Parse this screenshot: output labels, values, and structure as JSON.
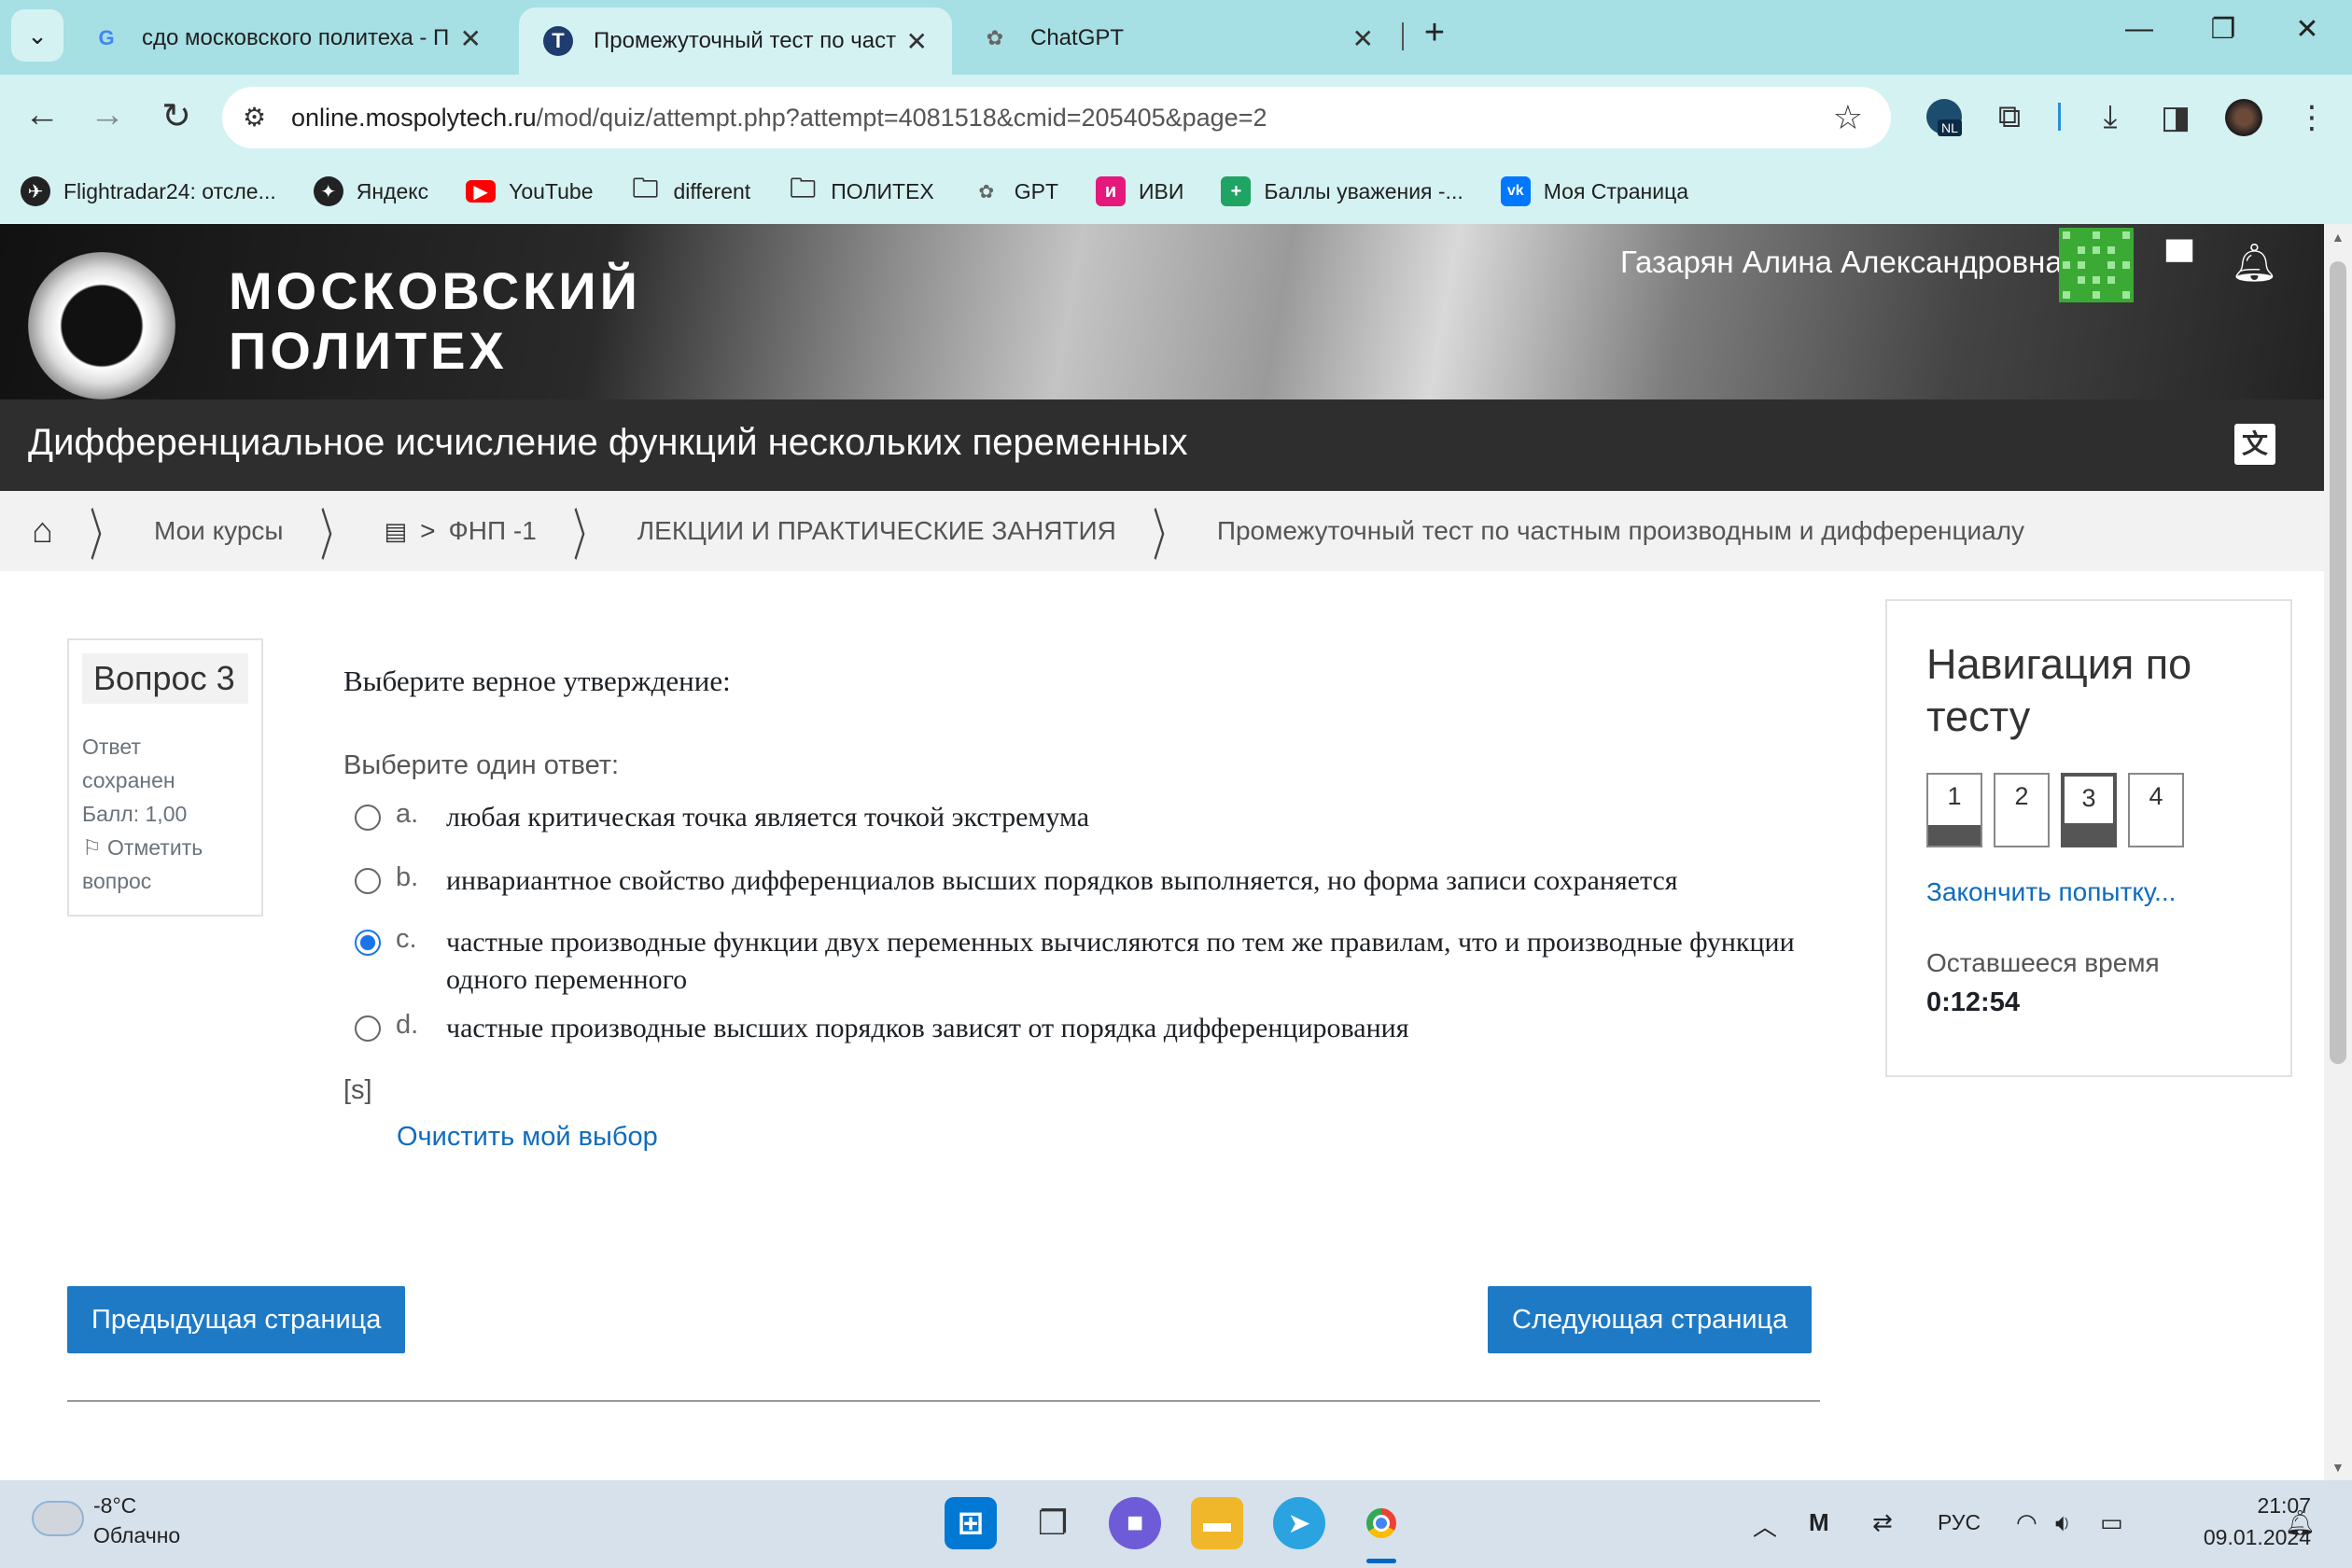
{
  "browser": {
    "tabs": [
      {
        "label": "сдо московского политеха - П",
        "icon": "google-icon"
      },
      {
        "label": "Промежуточный тест по частн",
        "icon": "moodle-icon",
        "active": true
      },
      {
        "label": "ChatGPT",
        "icon": "chatgpt-icon"
      }
    ],
    "new_tab": "+",
    "url_domain": "online.mospolytech.ru",
    "url_path": "/mod/quiz/attempt.php?attempt=4081518&cmid=205405&page=2",
    "bookmarks": [
      {
        "label": "Flightradar24: отсле...",
        "icon": "flightradar-icon",
        "color": "#222222"
      },
      {
        "label": "Яндекс",
        "icon": "yandex-icon",
        "color": "#222222"
      },
      {
        "label": "YouTube",
        "icon": "youtube-icon",
        "color": "#ff0000"
      },
      {
        "label": "different",
        "icon": "folder-icon",
        "color": ""
      },
      {
        "label": "ПОЛИТЕХ",
        "icon": "folder-icon",
        "color": ""
      },
      {
        "label": "GPT",
        "icon": "chatgpt-icon",
        "color": "#888888"
      },
      {
        "label": "ИВИ",
        "icon": "ivi-icon",
        "color": "#e5197c"
      },
      {
        "label": "Баллы уважения -...",
        "icon": "sheets-icon",
        "color": "#1fa463"
      },
      {
        "label": "Моя Страница",
        "icon": "vk-icon",
        "color": "#0077ff"
      }
    ],
    "extension_badge": "NL"
  },
  "site": {
    "logo_line1": "МОСКОВСКИЙ",
    "logo_line2": "ПОЛИТЕХ",
    "user_name": "Газарян Алина Александровна",
    "course_title": "Дифференциальное исчисление функций нескольких переменных",
    "breadcrumb": [
      "Мои курсы",
      "ФНП -1",
      "ЛЕКЦИИ И ПРАКТИЧЕСКИЕ ЗАНЯТИЯ",
      "Промежуточный тест по частным производным и дифференциалу"
    ]
  },
  "question": {
    "number_label": "Вопрос 3",
    "state_line1": "Ответ",
    "state_line2": "сохранен",
    "grade": "Балл: 1,00",
    "flag_line1": "Отметить",
    "flag_line2": "вопрос",
    "text": "Выберите верное утверждение:",
    "prompt": "Выберите один ответ:",
    "options": [
      {
        "letter": "a.",
        "text": "любая критическая точка является точкой экстремума",
        "selected": false
      },
      {
        "letter": "b.",
        "text": "инвариантное свойство дифференциалов высших порядков выполняется, но форма записи сохраняется",
        "selected": false
      },
      {
        "letter": "c.",
        "text": "частные производные функции двух переменных вычисляются по тем же правилам, что и производные функции одного переменного",
        "selected": true
      },
      {
        "letter": "d.",
        "text": "частные производные высших порядков зависят от порядка дифференцирования",
        "selected": false
      }
    ],
    "tag": "[s]",
    "clear_label": "Очистить мой выбор"
  },
  "buttons": {
    "prev": "Предыдущая страница",
    "next": "Следующая страница"
  },
  "quiz_nav": {
    "title": "Навигация по тесту",
    "questions": [
      "1",
      "2",
      "3",
      "4"
    ],
    "current": "3",
    "finish_label": "Закончить попытку...",
    "time_label": "Оставшееся время",
    "time_value": "0:12:54"
  },
  "taskbar": {
    "weather_temp": "-8°C",
    "weather_desc": "Облачно",
    "language": "РУС",
    "time": "21:07",
    "date": "09.01.2024"
  }
}
